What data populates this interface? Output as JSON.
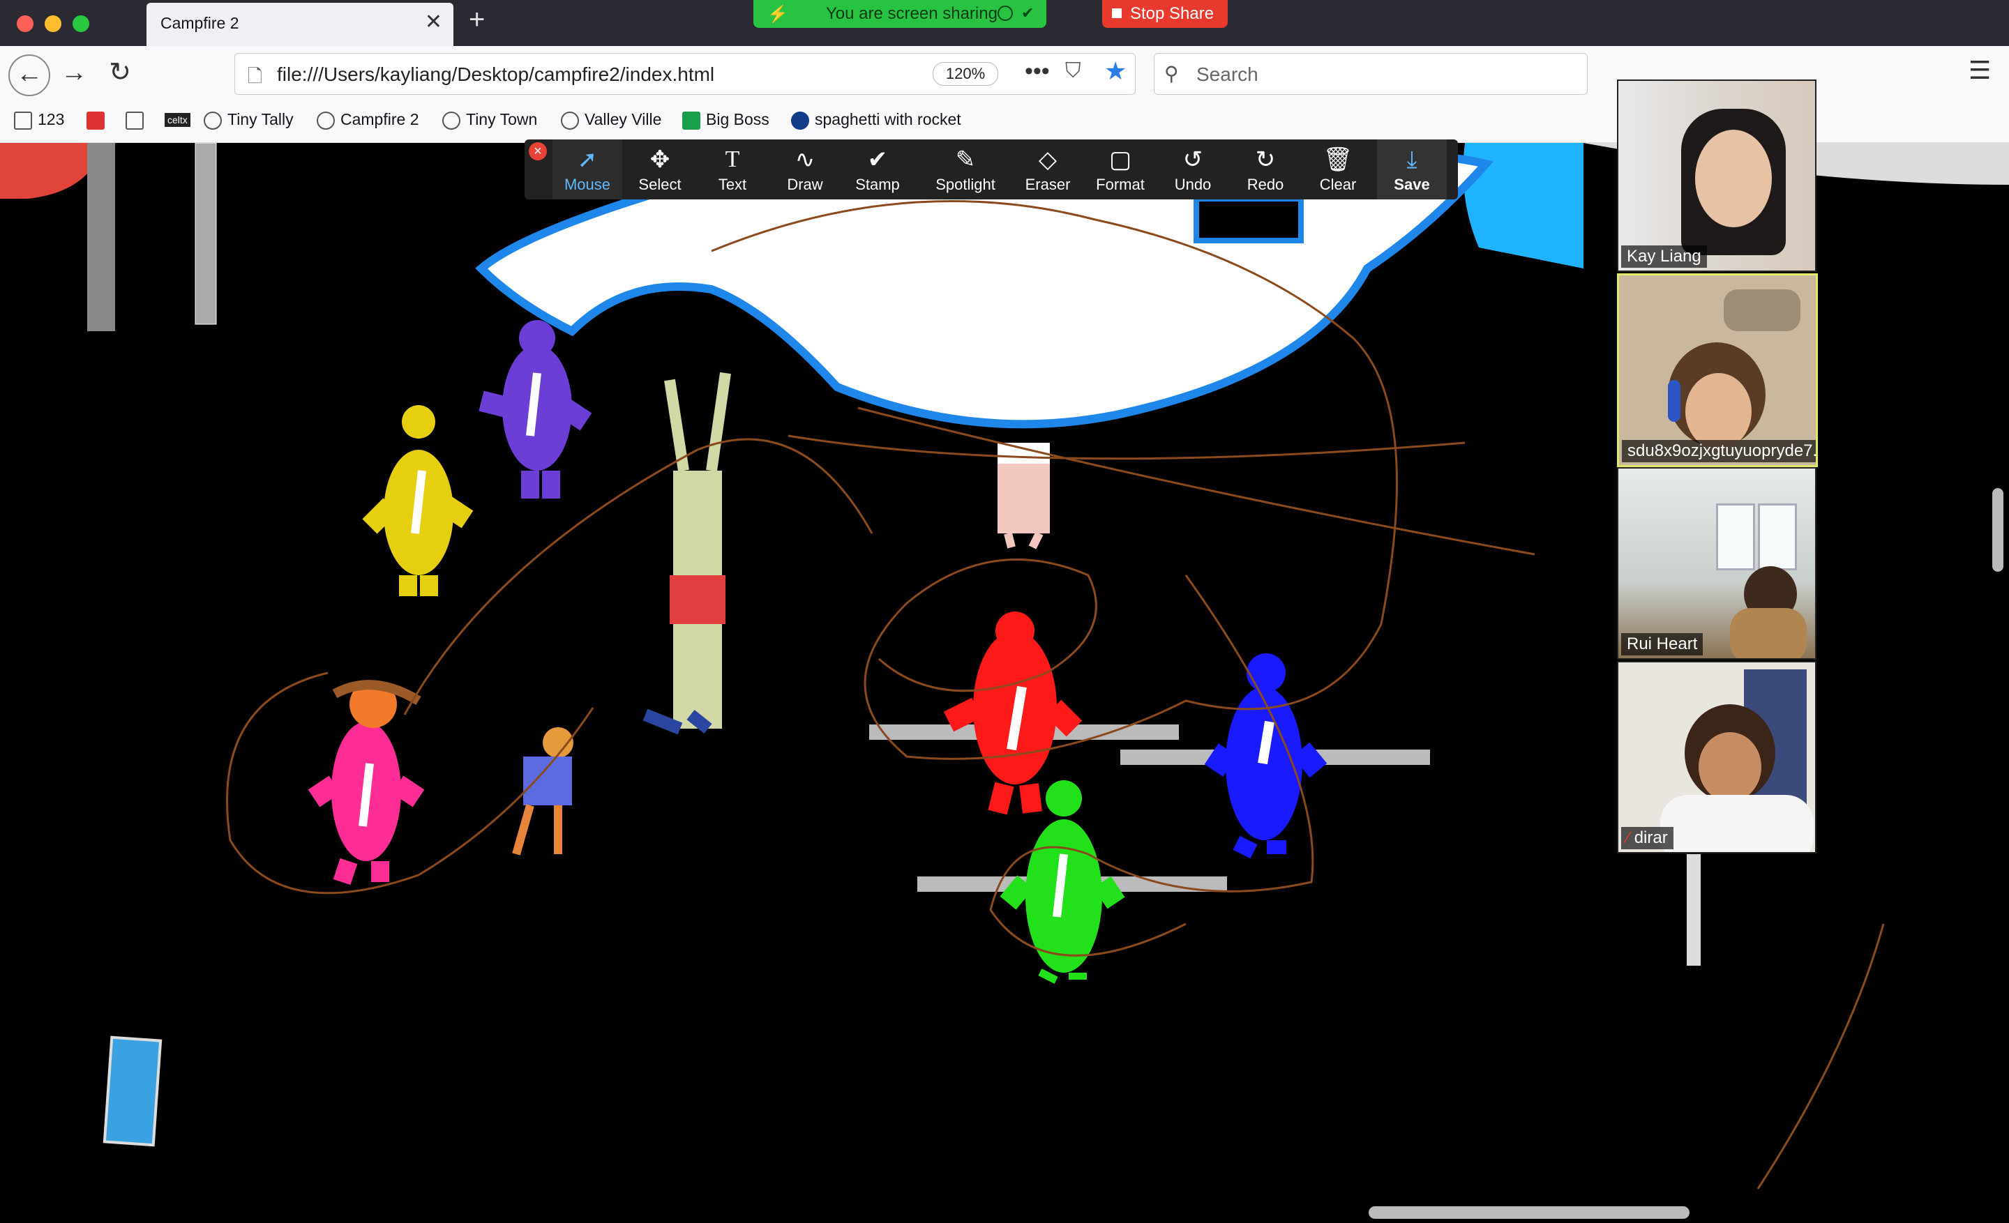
{
  "browser": {
    "tab_title": "Campfire 2",
    "tab_close": "✕",
    "new_tab": "+",
    "url": "file:///Users/kayliang/Desktop/campfire2/index.html",
    "zoom": "120%",
    "search_placeholder": "Search",
    "bookmarks": [
      "123",
      "Tiny Tally",
      "Campfire 2",
      "Tiny Town",
      "Valley Ville",
      "Big Boss",
      "spaghetti with rocket"
    ],
    "bookmark_icons": [
      "celtx"
    ]
  },
  "share": {
    "banner_text": "You are screen sharing",
    "stop_label": "Stop Share",
    "accent": "#28c343",
    "stop_color": "#e8392f"
  },
  "annotation_toolbar": {
    "tools": [
      {
        "label": "Mouse",
        "icon": "pointer-icon"
      },
      {
        "label": "Select",
        "icon": "move-icon"
      },
      {
        "label": "Text",
        "icon": "text-icon"
      },
      {
        "label": "Draw",
        "icon": "squiggle-icon"
      },
      {
        "label": "Stamp",
        "icon": "check-icon"
      },
      {
        "label": "Spotlight",
        "icon": "wand-icon"
      },
      {
        "label": "Eraser",
        "icon": "eraser-icon"
      },
      {
        "label": "Format",
        "icon": "square-icon"
      },
      {
        "label": "Undo",
        "icon": "undo-icon"
      },
      {
        "label": "Redo",
        "icon": "redo-icon"
      },
      {
        "label": "Clear",
        "icon": "trash-icon"
      },
      {
        "label": "Save",
        "icon": "save-icon"
      }
    ]
  },
  "participants": [
    {
      "name": "Kay Liang"
    },
    {
      "name": "sdu8x9ozjxgtuyuopryde7..."
    },
    {
      "name": "Rui Heart"
    },
    {
      "name": "dirar",
      "muted": true
    }
  ],
  "figures": {
    "colors": [
      "#6b3fd6",
      "#e6cf10",
      "#ff2d95",
      "#ff1a1a",
      "#1a1aff",
      "#22e01a"
    ]
  }
}
